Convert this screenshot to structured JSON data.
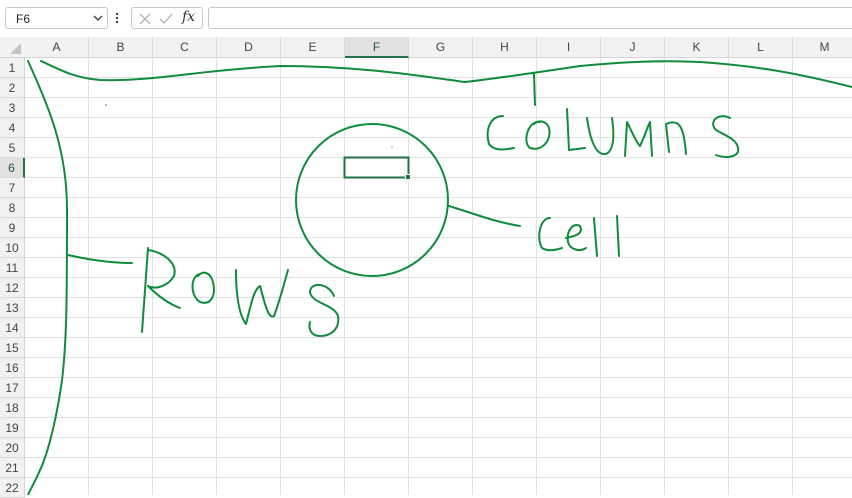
{
  "name_box": {
    "value": "F6"
  },
  "formula_bar": {
    "value": ""
  },
  "fx_label": "fx",
  "columns": [
    "A",
    "B",
    "C",
    "D",
    "E",
    "F",
    "G",
    "H",
    "I",
    "J",
    "K",
    "L",
    "M"
  ],
  "rows": [
    "1",
    "2",
    "3",
    "4",
    "5",
    "6",
    "7",
    "8",
    "9",
    "10",
    "11",
    "12",
    "13",
    "14",
    "15",
    "16",
    "17",
    "18",
    "19",
    "20",
    "21",
    "22"
  ],
  "selected_cell": {
    "column": "F",
    "row": "6"
  },
  "colors": {
    "accent": "#217346",
    "ink": "#118c3b",
    "grid": "#e1e1e1"
  },
  "icons": {
    "cancel": "x-icon",
    "enter": "check-icon",
    "insert_function": "fx-icon"
  }
}
